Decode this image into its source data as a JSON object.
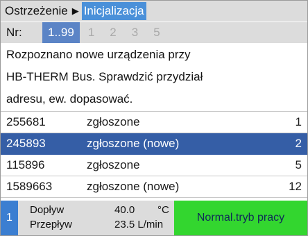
{
  "breadcrumb": {
    "parent": "Ostrzeżenie",
    "arrow_icon": "right-triangle-icon",
    "current": "Inicjalizacja"
  },
  "nr_row": {
    "label": "Nr:",
    "tabs": [
      {
        "label": "1..99",
        "active": true
      },
      {
        "label": "1",
        "active": false
      },
      {
        "label": "2",
        "active": false
      },
      {
        "label": "3",
        "active": false
      },
      {
        "label": "5",
        "active": false
      }
    ]
  },
  "message": {
    "lines": [
      "Rozpoznano nowe urządzenia przy",
      "HB-THERM Bus. Sprawdzić przydział",
      "adresu, ew. dopasować."
    ]
  },
  "devices": [
    {
      "id": "255681",
      "status": "zgłoszone",
      "number": "1",
      "selected": false
    },
    {
      "id": "245893",
      "status": "zgłoszone (nowe)",
      "number": "2",
      "selected": true
    },
    {
      "id": "115896",
      "status": "zgłoszone",
      "number": "5",
      "selected": false
    },
    {
      "id": "1589663",
      "status": "zgłoszone (nowe)",
      "number": "12",
      "selected": false
    }
  ],
  "status_bar": {
    "index": "1",
    "supply_label": "Dopływ",
    "supply_value": "40.0",
    "supply_unit": "°C",
    "flow_label": "Przepływ",
    "flow_value": "23.5 L/min",
    "mode": "Normal.tryb pracy"
  },
  "colors": {
    "header_bg": "#dcdcdc",
    "breadcrumb_current_bg": "#4a90d9",
    "active_tab_bg": "#5b84c6",
    "selected_row_bg": "#355ea6",
    "status_index_bg": "#3b7ed1",
    "mode_bg": "#33d62f"
  }
}
